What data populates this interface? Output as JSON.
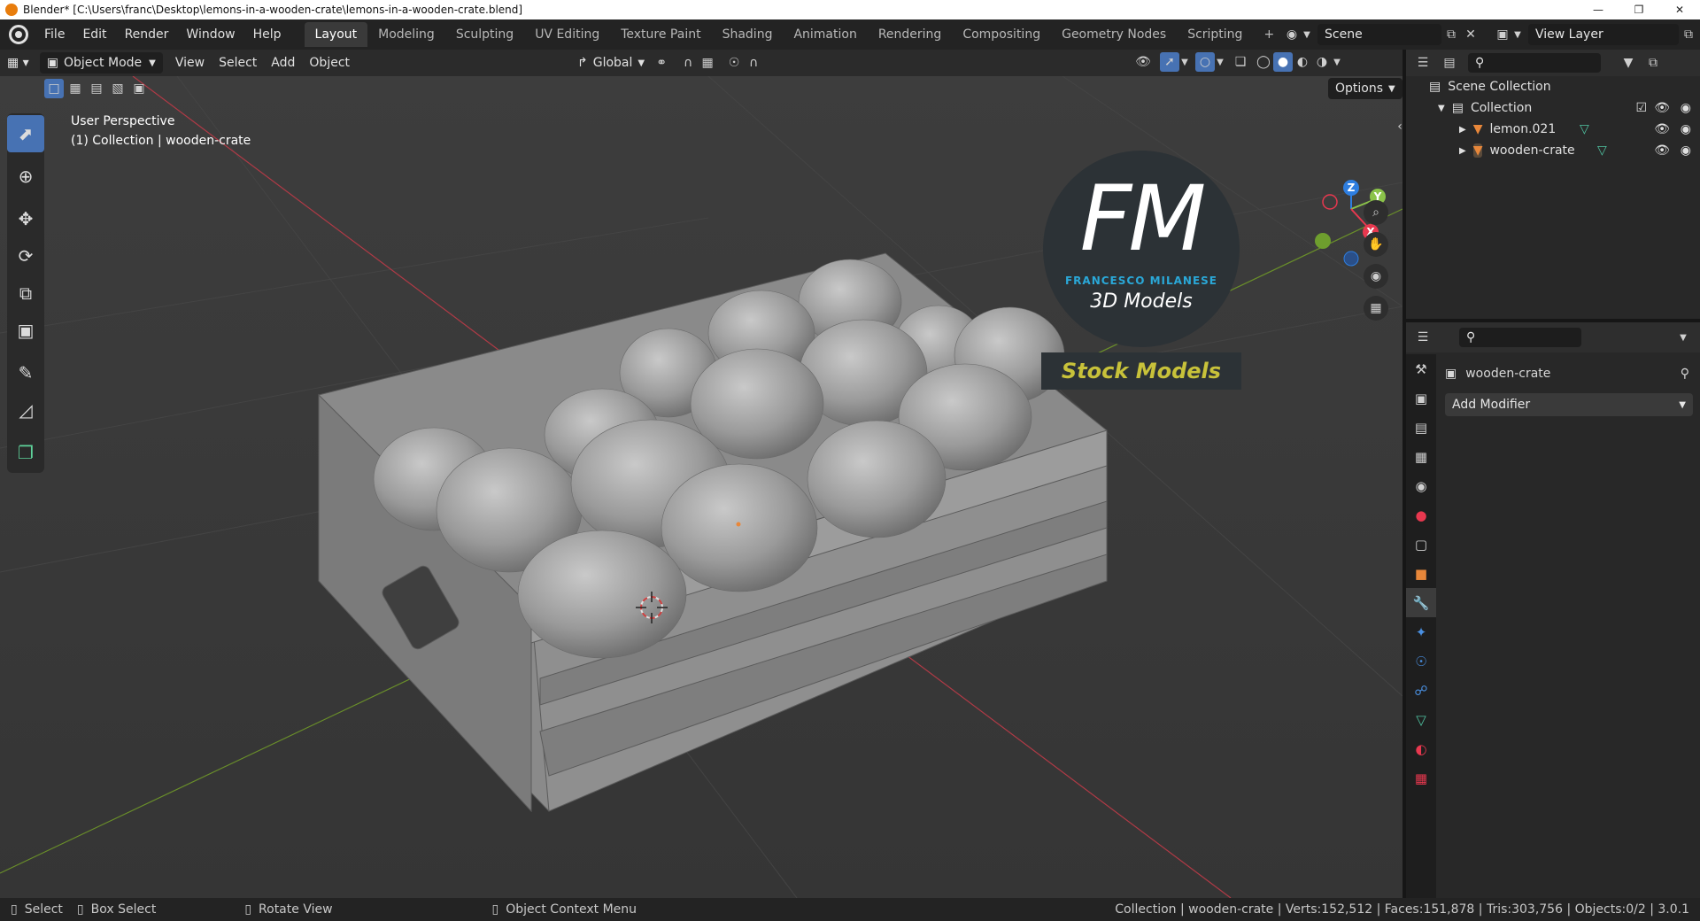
{
  "window": {
    "title": "Blender* [C:\\Users\\franc\\Desktop\\lemons-in-a-wooden-crate\\lemons-in-a-wooden-crate.blend]"
  },
  "menu": [
    "File",
    "Edit",
    "Render",
    "Window",
    "Help"
  ],
  "workspaces": [
    {
      "label": "Layout",
      "active": true
    },
    {
      "label": "Modeling"
    },
    {
      "label": "Sculpting"
    },
    {
      "label": "UV Editing"
    },
    {
      "label": "Texture Paint"
    },
    {
      "label": "Shading"
    },
    {
      "label": "Animation"
    },
    {
      "label": "Rendering"
    },
    {
      "label": "Compositing"
    },
    {
      "label": "Geometry Nodes"
    },
    {
      "label": "Scripting"
    }
  ],
  "scene": {
    "name": "Scene"
  },
  "view_layer": {
    "name": "View Layer"
  },
  "viewport_header": {
    "mode": "Object Mode",
    "menus": [
      "View",
      "Select",
      "Add",
      "Object"
    ],
    "transform_orientation": "Global",
    "options_label": "Options"
  },
  "viewport": {
    "perspective": "User Perspective",
    "context": "(1) Collection | wooden-crate",
    "watermark": {
      "logo": "FM",
      "author": "FRANCESCO MILANESE",
      "subtitle": "3D Models",
      "banner": "Stock Models"
    },
    "gizmo_axes": [
      "Z",
      "Y",
      "X"
    ]
  },
  "tools": [
    "select-box",
    "cursor",
    "move",
    "rotate",
    "scale",
    "transform",
    "annotate",
    "measure",
    "add-cube"
  ],
  "outliner": {
    "root": "Scene Collection",
    "collection": "Collection",
    "items": [
      {
        "name": "lemon.021"
      },
      {
        "name": "wooden-crate"
      }
    ]
  },
  "properties": {
    "object_name": "wooden-crate",
    "add_modifier": "Add Modifier",
    "active_tab": "modifiers"
  },
  "status": {
    "left": [
      {
        "key": "mouse-left-icon",
        "label": "Select"
      },
      {
        "key": "box-select-icon",
        "label": "Box Select"
      },
      {
        "key": "mouse-middle-icon",
        "label": "Rotate View"
      },
      {
        "key": "mouse-right-icon",
        "label": "Object Context Menu"
      }
    ],
    "right": "Collection | wooden-crate | Verts:152,512 | Faces:151,878 | Tris:303,756 | Objects:0/2 | 3.0.1"
  },
  "colors": {
    "accent": "#4772b3",
    "logo_blue": "#2aa8d8",
    "banner_text": "#c8c23a",
    "axis_x": "#e8384f",
    "axis_y": "#8bc34a",
    "axis_z": "#2e7ee0",
    "object_orange": "#e8873a",
    "mesh_green": "#4fc3a1"
  }
}
